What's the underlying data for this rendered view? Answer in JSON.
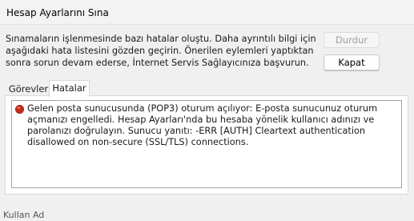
{
  "window": {
    "title": "Hesap Ayarlarını Sına"
  },
  "message_lines": [
    "Sınamaların işlenmesinde bazı hatalar oluştu. Daha ayrıntılı bilgi için",
    "aşağıdaki hata listesini gözden geçirin. Önerilen eylemleri yaptıktan",
    "sonra sorun devam ederse, İnternet Servis Sağlayıcınıza başvurun."
  ],
  "buttons": {
    "stop": "Durdur",
    "close": "Kapat"
  },
  "tabs": [
    {
      "label": "Görevler",
      "selected": false
    },
    {
      "label": "Hatalar",
      "selected": true
    }
  ],
  "errors": [
    {
      "icon": "error-circle-icon",
      "lines": [
        "Gelen posta sunucusunda (POP3) oturum açılıyor: E-posta sunucunuz oturum",
        "açmanızı engelledi. Hesap Ayarları'nda bu hesaba yönelik kullanıcı adınızı ve",
        "parolanızı doğrulayın.  Sunucu yanıtı: -ERR [AUTH] Cleartext authentication",
        "disallowed on non-secure (SSL/TLS) connections."
      ]
    }
  ],
  "background_window": {
    "partial_text": "Kullan  Ad"
  },
  "colors": {
    "error_red": "#c42b1c",
    "window_bg": "#f0f0f0",
    "disabled_text": "#a0a0a0"
  }
}
